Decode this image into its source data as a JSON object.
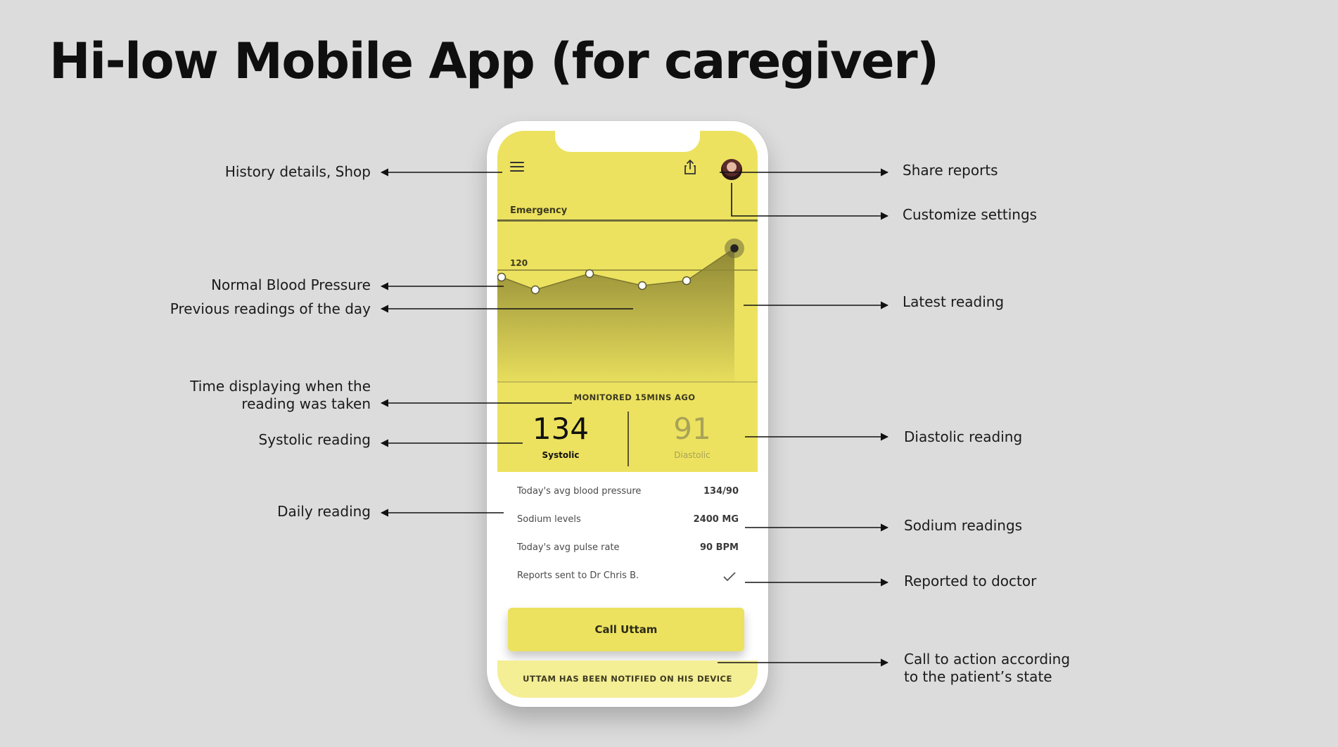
{
  "page": {
    "title": "Hi-low Mobile App (for caregiver)"
  },
  "app": {
    "emergency_label": "Emergency",
    "normal_bp_value": "120",
    "monitored": "MONITORED 15MINS AGO",
    "systolic": {
      "value": "134",
      "label": "Systolic"
    },
    "diastolic": {
      "value": "91",
      "label": "Diastolic"
    },
    "stats": [
      {
        "label": "Today's avg blood pressure",
        "value": "134/90"
      },
      {
        "label": "Sodium levels",
        "value": "2400 MG"
      },
      {
        "label": "Today's avg pulse rate",
        "value": "90 BPM"
      },
      {
        "label": "Reports sent to Dr Chris B.",
        "value": ""
      }
    ],
    "cta": "Call Uttam",
    "notification": "UTTAM HAS BEEN NOTIFIED ON HIS DEVICE",
    "reading_trend": [
      0.8,
      0.65,
      1.0,
      0.7,
      0.75,
      2.6
    ],
    "colors": {
      "accent": "#ece25f",
      "area": "#8f8835",
      "banner": "#f4ee95"
    },
    "icons": [
      "menu-icon",
      "share-icon",
      "avatar",
      "check-icon"
    ]
  },
  "callouts": {
    "history": "History details, Shop",
    "share": "Share reports",
    "settings": "Customize settings",
    "normal_bp": "Normal Blood Pressure",
    "previous": "Previous readings of the day",
    "latest": "Latest reading",
    "time_line1": "Time displaying when the",
    "time_line2": "reading was taken",
    "systolic": "Systolic reading",
    "diastolic": "Diastolic reading",
    "daily": "Daily reading",
    "sodium": "Sodium readings",
    "doctor": "Reported to doctor",
    "cta_line1": "Call to action according",
    "cta_line2": "to the patient’s state"
  }
}
